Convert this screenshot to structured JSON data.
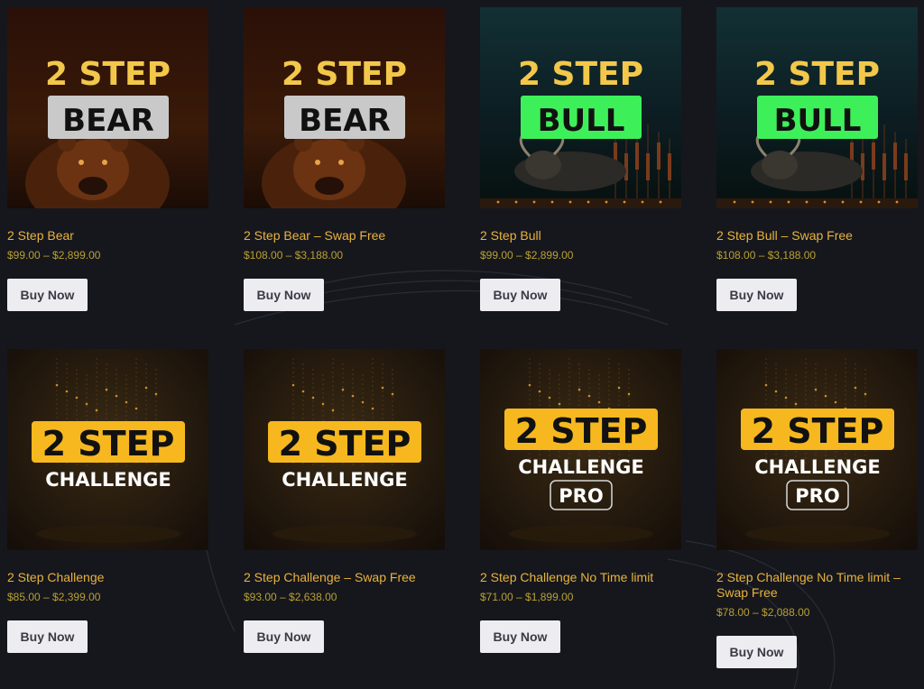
{
  "products": [
    {
      "title": "2 Step Bear",
      "price": "$99.00 – $2,899.00",
      "button": "Buy Now",
      "art": {
        "line1": "2 STEP",
        "line2": "BEAR",
        "line3": "",
        "theme": "bear",
        "accent": "#f3c84a",
        "badge": "#c9c9c9"
      }
    },
    {
      "title": "2 Step Bear – Swap Free",
      "price": "$108.00 – $3,188.00",
      "button": "Buy Now",
      "art": {
        "line1": "2 STEP",
        "line2": "BEAR",
        "line3": "",
        "theme": "bear",
        "accent": "#f3c84a",
        "badge": "#c9c9c9"
      }
    },
    {
      "title": "2 Step Bull",
      "price": "$99.00 – $2,899.00",
      "button": "Buy Now",
      "art": {
        "line1": "2 STEP",
        "line2": "BULL",
        "line3": "",
        "theme": "bull",
        "accent": "#f3c84a",
        "badge": "#3df05a"
      }
    },
    {
      "title": "2 Step Bull – Swap Free",
      "price": "$108.00 – $3,188.00",
      "button": "Buy Now",
      "art": {
        "line1": "2 STEP",
        "line2": "BULL",
        "line3": "",
        "theme": "bull",
        "accent": "#f3c84a",
        "badge": "#3df05a"
      }
    },
    {
      "title": "2 Step Challenge",
      "price": "$85.00 – $2,399.00",
      "button": "Buy Now",
      "art": {
        "line1": "2 STEP",
        "line2": "CHALLENGE",
        "line3": "",
        "theme": "challenge",
        "accent": "#f6b81e",
        "badge": "#ffffff"
      }
    },
    {
      "title": "2 Step Challenge – Swap Free",
      "price": "$93.00 – $2,638.00",
      "button": "Buy Now",
      "art": {
        "line1": "2 STEP",
        "line2": "CHALLENGE",
        "line3": "",
        "theme": "challenge",
        "accent": "#f6b81e",
        "badge": "#ffffff"
      }
    },
    {
      "title": "2 Step Challenge No Time limit",
      "price": "$71.00 – $1,899.00",
      "button": "Buy Now",
      "art": {
        "line1": "2 STEP",
        "line2": "CHALLENGE",
        "line3": "PRO",
        "theme": "challenge",
        "accent": "#f6b81e",
        "badge": "#ffffff"
      }
    },
    {
      "title": "2 Step Challenge No Time limit – Swap Free",
      "price": "$78.00 – $2,088.00",
      "button": "Buy Now",
      "art": {
        "line1": "2 STEP",
        "line2": "CHALLENGE",
        "line3": "PRO",
        "theme": "challenge",
        "accent": "#f6b81e",
        "badge": "#ffffff"
      }
    }
  ]
}
